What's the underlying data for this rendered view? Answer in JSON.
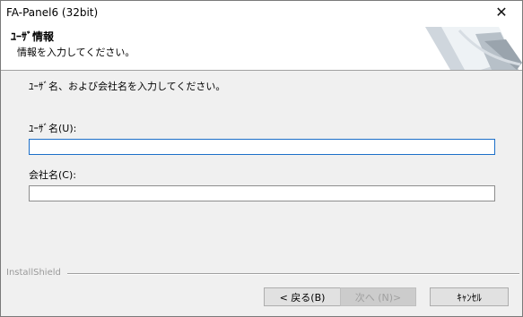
{
  "window": {
    "title": "FA-Panel6 (32bit)"
  },
  "header": {
    "title": "ﾕｰｻﾞ情報",
    "subtitle": "情報を入力してください。"
  },
  "main": {
    "instruction": "ﾕｰｻﾞ名、および会社名を入力してください。",
    "user_label": "ﾕｰｻﾞ名(U):",
    "user_value": "",
    "company_label": "会社名(C):",
    "company_value": ""
  },
  "footer": {
    "brand": "InstallShield",
    "back_label": "< 戻る(B)",
    "next_label": "次へ (N)>",
    "cancel_label": "ｷｬﾝｾﾙ"
  },
  "icons": {
    "close": "close-icon"
  }
}
